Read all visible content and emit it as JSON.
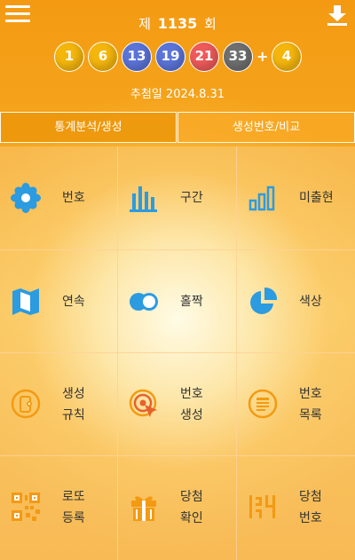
{
  "header": {
    "round_prefix": "제",
    "round_number": "1135",
    "round_suffix": "회",
    "balls": [
      "1",
      "6",
      "13",
      "19",
      "21",
      "33"
    ],
    "bonus": "4",
    "plus": "+",
    "draw_date": "추첨일  2024.8.31"
  },
  "tabs": [
    {
      "label": "통계분석/생성"
    },
    {
      "label": "생성번호/비교"
    }
  ],
  "grid": [
    {
      "line1": "번호",
      "line2": "",
      "icon": "flower-icon"
    },
    {
      "line1": "구간",
      "line2": "",
      "icon": "bar-chart-icon"
    },
    {
      "line1": "미출현",
      "line2": "",
      "icon": "ascending-bars-icon"
    },
    {
      "line1": "연속",
      "line2": "",
      "icon": "map-icon"
    },
    {
      "line1": "홀짝",
      "line2": "",
      "icon": "toggle-circles-icon"
    },
    {
      "line1": "색상",
      "line2": "",
      "icon": "pie-chart-icon"
    },
    {
      "line1": "생성",
      "line2": "규칙",
      "icon": "phone-gear-icon"
    },
    {
      "line1": "번호",
      "line2": "생성",
      "icon": "target-icon"
    },
    {
      "line1": "번호",
      "line2": "목록",
      "icon": "document-list-icon"
    },
    {
      "line1": "로또",
      "line2": "등록",
      "icon": "qr-code-icon"
    },
    {
      "line1": "당첨",
      "line2": "확인",
      "icon": "gift-icon"
    },
    {
      "line1": "당첨",
      "line2": "번호",
      "icon": "number-digits-icon"
    }
  ],
  "colors": {
    "ball_yellow": "#f5b60c",
    "ball_blue": "#5b74d8",
    "ball_red": "#ee5a5a",
    "ball_gray": "#6f6f6f",
    "icon_blue": "#2c9be0",
    "icon_orange": "#f39a12"
  }
}
